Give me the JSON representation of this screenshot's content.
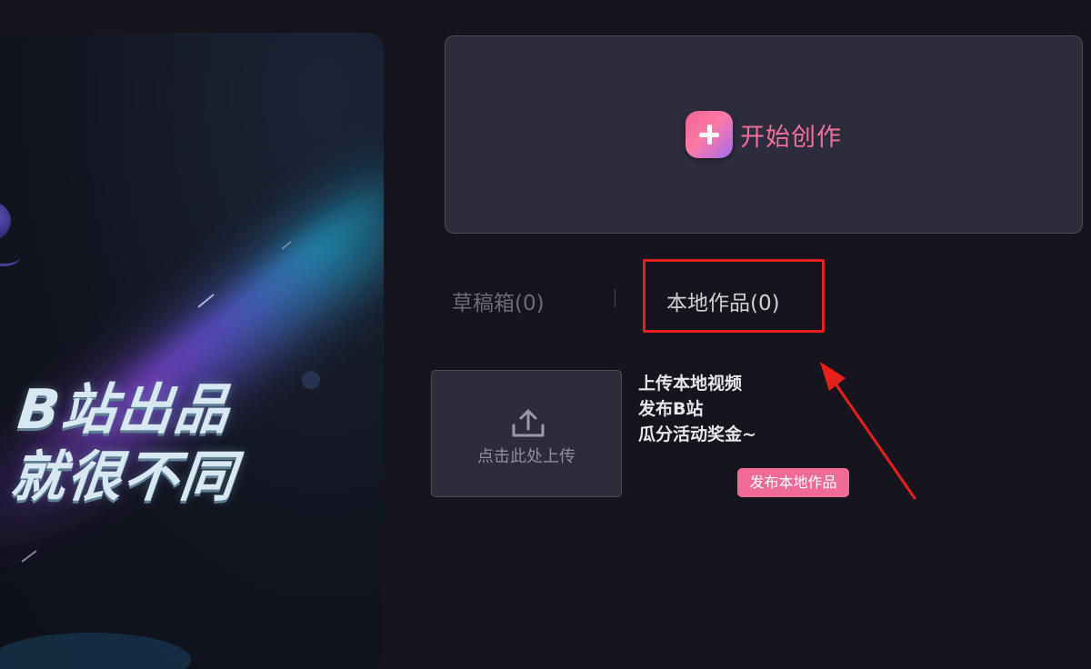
{
  "banner": {
    "slogan_line1": "B站出品",
    "slogan_line2": "就很不同"
  },
  "create": {
    "label": "开始创作",
    "icon": "plus-icon"
  },
  "tabs": [
    {
      "label": "草稿箱(0)",
      "active": false
    },
    {
      "label": "本地作品(0)",
      "active": true
    }
  ],
  "upload": {
    "label": "点击此处上传",
    "icon": "upload-icon"
  },
  "promo": {
    "lines": [
      "上传本地视频",
      "发布B站",
      "瓜分活动奖金~"
    ],
    "badge": "发布本地作品"
  },
  "colors": {
    "accent_pink": "#f06a96",
    "highlight_red": "#e8201d",
    "background": "#16151d",
    "card": "#2d2c3d"
  }
}
